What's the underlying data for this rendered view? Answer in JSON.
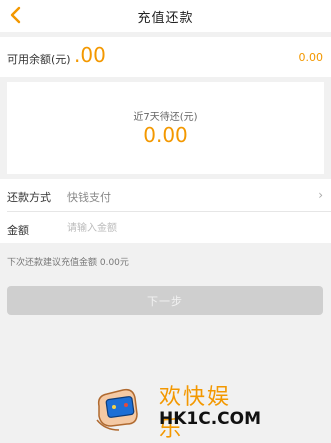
{
  "header": {
    "title": "充值还款"
  },
  "balance": {
    "label": "可用余额(元)",
    "big_value": ".00",
    "right_value": "0.00"
  },
  "due": {
    "label": "近7天待还(元)",
    "value": "0.00"
  },
  "form": {
    "method_label": "还款方式",
    "method_value": "快钱支付",
    "amount_label": "金额",
    "amount_placeholder": "请输入金额"
  },
  "hint": "下次还款建议充值金额 0.00元",
  "next_button": "下一步",
  "watermark": {
    "text_cn": "欢快娱乐",
    "text_en": "HK1C.COM"
  },
  "colors": {
    "accent": "#f39800",
    "button_disabled": "#cfcfcf",
    "background": "#f1f1f1"
  }
}
